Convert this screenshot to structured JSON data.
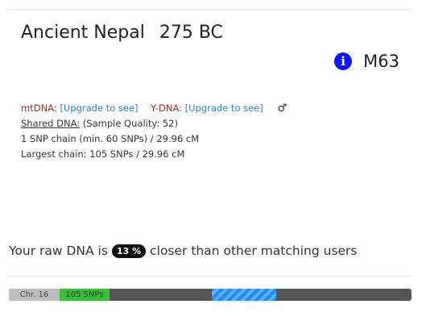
{
  "card": {
    "region": "Ancient Nepal",
    "date": "275 BC",
    "haplogroup": "M63"
  },
  "details": {
    "mtdna_label": "mtDNA:",
    "mtdna_link": "[Upgrade to see]",
    "ydna_label": "Y-DNA:",
    "ydna_link": "[Upgrade to see]",
    "sex_symbol": "♂",
    "shared_label": "Shared DNA:",
    "sample_quality": "(Sample Quality: 52)",
    "snp_chain": "1 SNP chain (min. 60 SNPs) / 29.96 cM",
    "largest_chain": "Largest chain: 105 SNPs / 29.96 cM"
  },
  "raw": {
    "prefix": "Your raw DNA is",
    "percent": "13 %",
    "suffix": "closer than other matching users"
  },
  "chromosome": {
    "label": "Chr. 16",
    "snps": "105 SNPs"
  },
  "colors": {
    "info_icon": "#0f19f0",
    "link": "#2f7fd4",
    "snp_green": "#3cbd3c",
    "segment_blue": "#1e88ff"
  },
  "icons": {
    "info": "info-icon",
    "sex": "male-icon"
  }
}
